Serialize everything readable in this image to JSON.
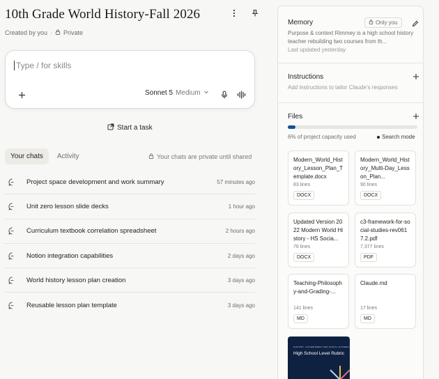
{
  "project": {
    "title": "10th Grade World History-Fall 2026",
    "created_by": "Created by you",
    "visibility": "Private"
  },
  "composer": {
    "placeholder": "Type / for skills",
    "model": "Sonnet 5",
    "effort": "Medium"
  },
  "start_task": "Start a task",
  "tabs": [
    {
      "label": "Your chats",
      "active": true
    },
    {
      "label": "Activity",
      "active": false
    }
  ],
  "privacy_note": "Your chats are private until shared",
  "chats": [
    {
      "title": "Project space development and work summary",
      "time": "57 minutes ago"
    },
    {
      "title": "Unit zero lesson slide decks",
      "time": "1 hour ago"
    },
    {
      "title": "Curriculum textbook correlation spreadsheet",
      "time": "2 hours ago"
    },
    {
      "title": "Notion integration capabilities",
      "time": "2 days ago"
    },
    {
      "title": "World history lesson plan creation",
      "time": "3 days ago"
    },
    {
      "title": "Reusable lesson plan template",
      "time": "3 days ago"
    }
  ],
  "memory": {
    "heading": "Memory",
    "badge": "Only you",
    "text": "Purpose & context Rimmey is a high school history teacher rebuilding two courses from th...",
    "updated": "Last updated yesterday"
  },
  "instructions": {
    "heading": "Instructions",
    "placeholder": "Add instructions to tailor Claude's responses"
  },
  "files": {
    "heading": "Files",
    "capacity_text": "6% of project capacity used",
    "capacity_fraction": 0.06,
    "search_mode": "Search mode",
    "items": [
      {
        "name": "Modern_World_History_Lesson_Plan_Template.docx",
        "lines": "83 lines",
        "type": "DOCX"
      },
      {
        "name": "Modern_World_History_Multi-Day_Lesson_Plan...",
        "lines": "90 lines",
        "type": "DOCX"
      },
      {
        "name": "Updated Version 2022 Modern World History - HS Socia...",
        "lines": "76 lines",
        "type": "DOCX"
      },
      {
        "name": "c3-framework-for-social-studies-rev0617.2.pdf",
        "lines": "7,377 lines",
        "type": "PDF"
      },
      {
        "name": "Teaching-Philosophy-and-Grading-...",
        "lines": "141 lines",
        "type": "MD"
      },
      {
        "name": "Claude.md",
        "lines": "17 lines",
        "type": "MD"
      }
    ],
    "thumbnail": {
      "small_caption": "HISTORY, GOVERNMENT AND SOCIAL STUDIES",
      "title": "High School Level Rubric"
    }
  },
  "colors": {
    "accent": "#1e4f8f",
    "background": "#f7f7f5",
    "panel": "#fbfbf9"
  }
}
